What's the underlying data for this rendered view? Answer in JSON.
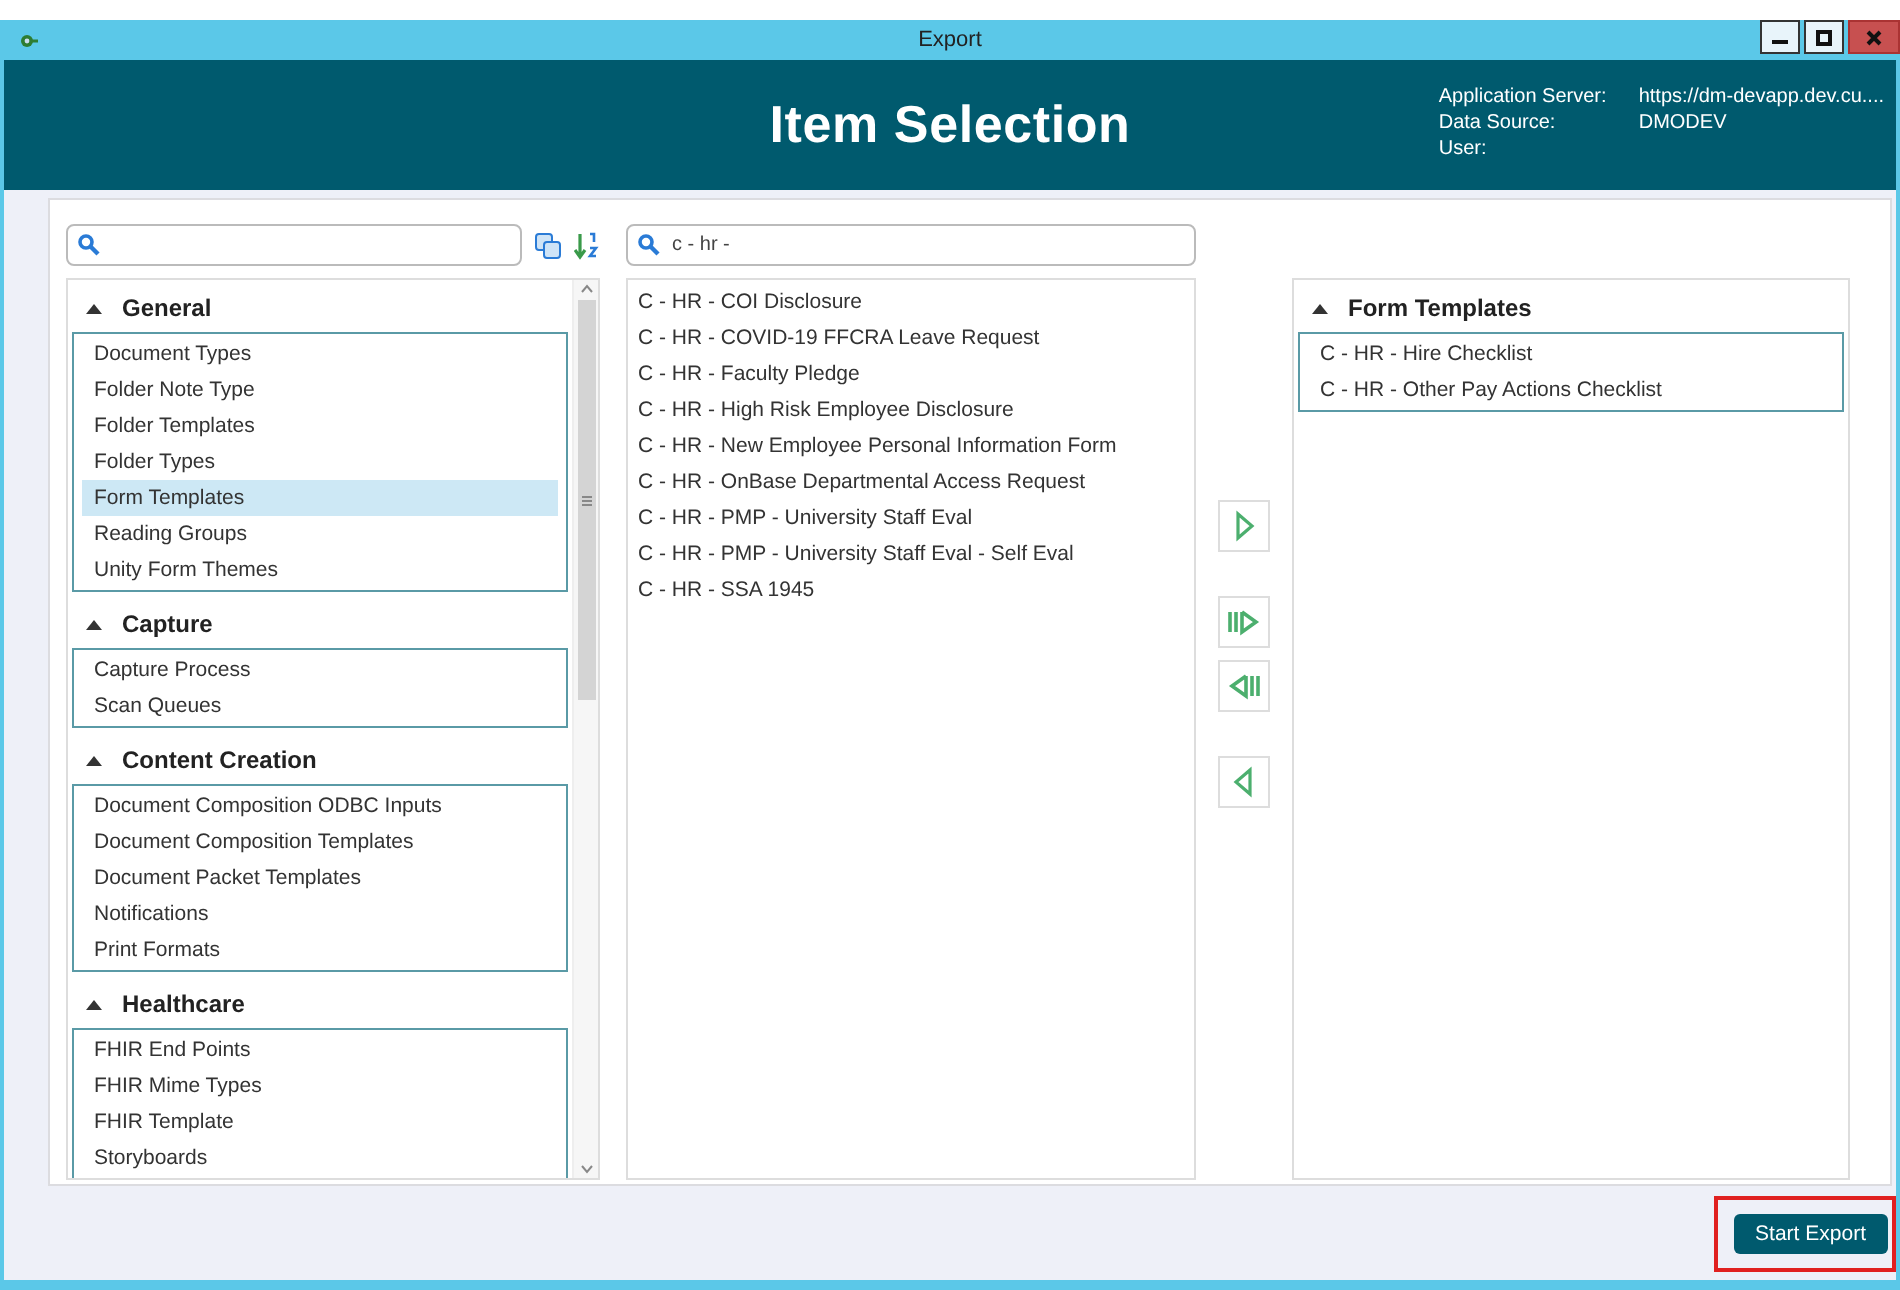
{
  "window": {
    "title": "Export"
  },
  "header": {
    "title": "Item Selection",
    "info": [
      {
        "label": "Application Server:",
        "value": "https://dm-devapp.dev.cu...."
      },
      {
        "label": "Data Source:",
        "value": "DMODEV"
      },
      {
        "label": "User:"
      }
    ]
  },
  "categories": [
    {
      "title": "General",
      "expanded": true,
      "items": [
        {
          "label": "Document Types",
          "selected": false
        },
        {
          "label": "Folder Note Type",
          "selected": false
        },
        {
          "label": "Folder Templates",
          "selected": false
        },
        {
          "label": "Folder Types",
          "selected": false
        },
        {
          "label": "Form Templates",
          "selected": true
        },
        {
          "label": "Reading Groups",
          "selected": false
        },
        {
          "label": "Unity Form Themes",
          "selected": false
        }
      ]
    },
    {
      "title": "Capture",
      "expanded": true,
      "items": [
        {
          "label": "Capture Process",
          "selected": false
        },
        {
          "label": "Scan Queues",
          "selected": false
        }
      ]
    },
    {
      "title": "Content Creation",
      "expanded": true,
      "items": [
        {
          "label": "Document Composition ODBC Inputs",
          "selected": false
        },
        {
          "label": "Document Composition Templates",
          "selected": false
        },
        {
          "label": "Document Packet Templates",
          "selected": false
        },
        {
          "label": "Notifications",
          "selected": false
        },
        {
          "label": "Print Formats",
          "selected": false
        }
      ]
    },
    {
      "title": "Healthcare",
      "expanded": true,
      "items": [
        {
          "label": "FHIR End Points",
          "selected": false
        },
        {
          "label": "FHIR Mime Types",
          "selected": false
        },
        {
          "label": "FHIR Template",
          "selected": false
        },
        {
          "label": "Storyboards",
          "selected": false
        }
      ]
    }
  ],
  "item_search": {
    "value": "c - hr -"
  },
  "available_items": [
    "C - HR - COI Disclosure",
    "C - HR - COVID-19 FFCRA Leave Request",
    "C - HR - Faculty Pledge",
    "C - HR - High Risk Employee Disclosure",
    "C - HR - New Employee Personal Information Form",
    "C - HR - OnBase Departmental Access Request",
    "C - HR - PMP - University Staff Eval",
    "C - HR - PMP - University Staff Eval - Self Eval",
    "C - HR - SSA 1945"
  ],
  "transfer_buttons": [
    {
      "kind": "add"
    },
    {
      "kind": "add_all"
    },
    {
      "kind": "remove_all"
    },
    {
      "kind": "remove"
    }
  ],
  "selected_groups": [
    {
      "title": "Form Templates",
      "expanded": true,
      "items": [
        "C - HR - Hire Checklist",
        "C - HR - Other Pay Actions Checklist"
      ]
    }
  ],
  "footer": {
    "button": "Start Export",
    "highlighted": true
  }
}
